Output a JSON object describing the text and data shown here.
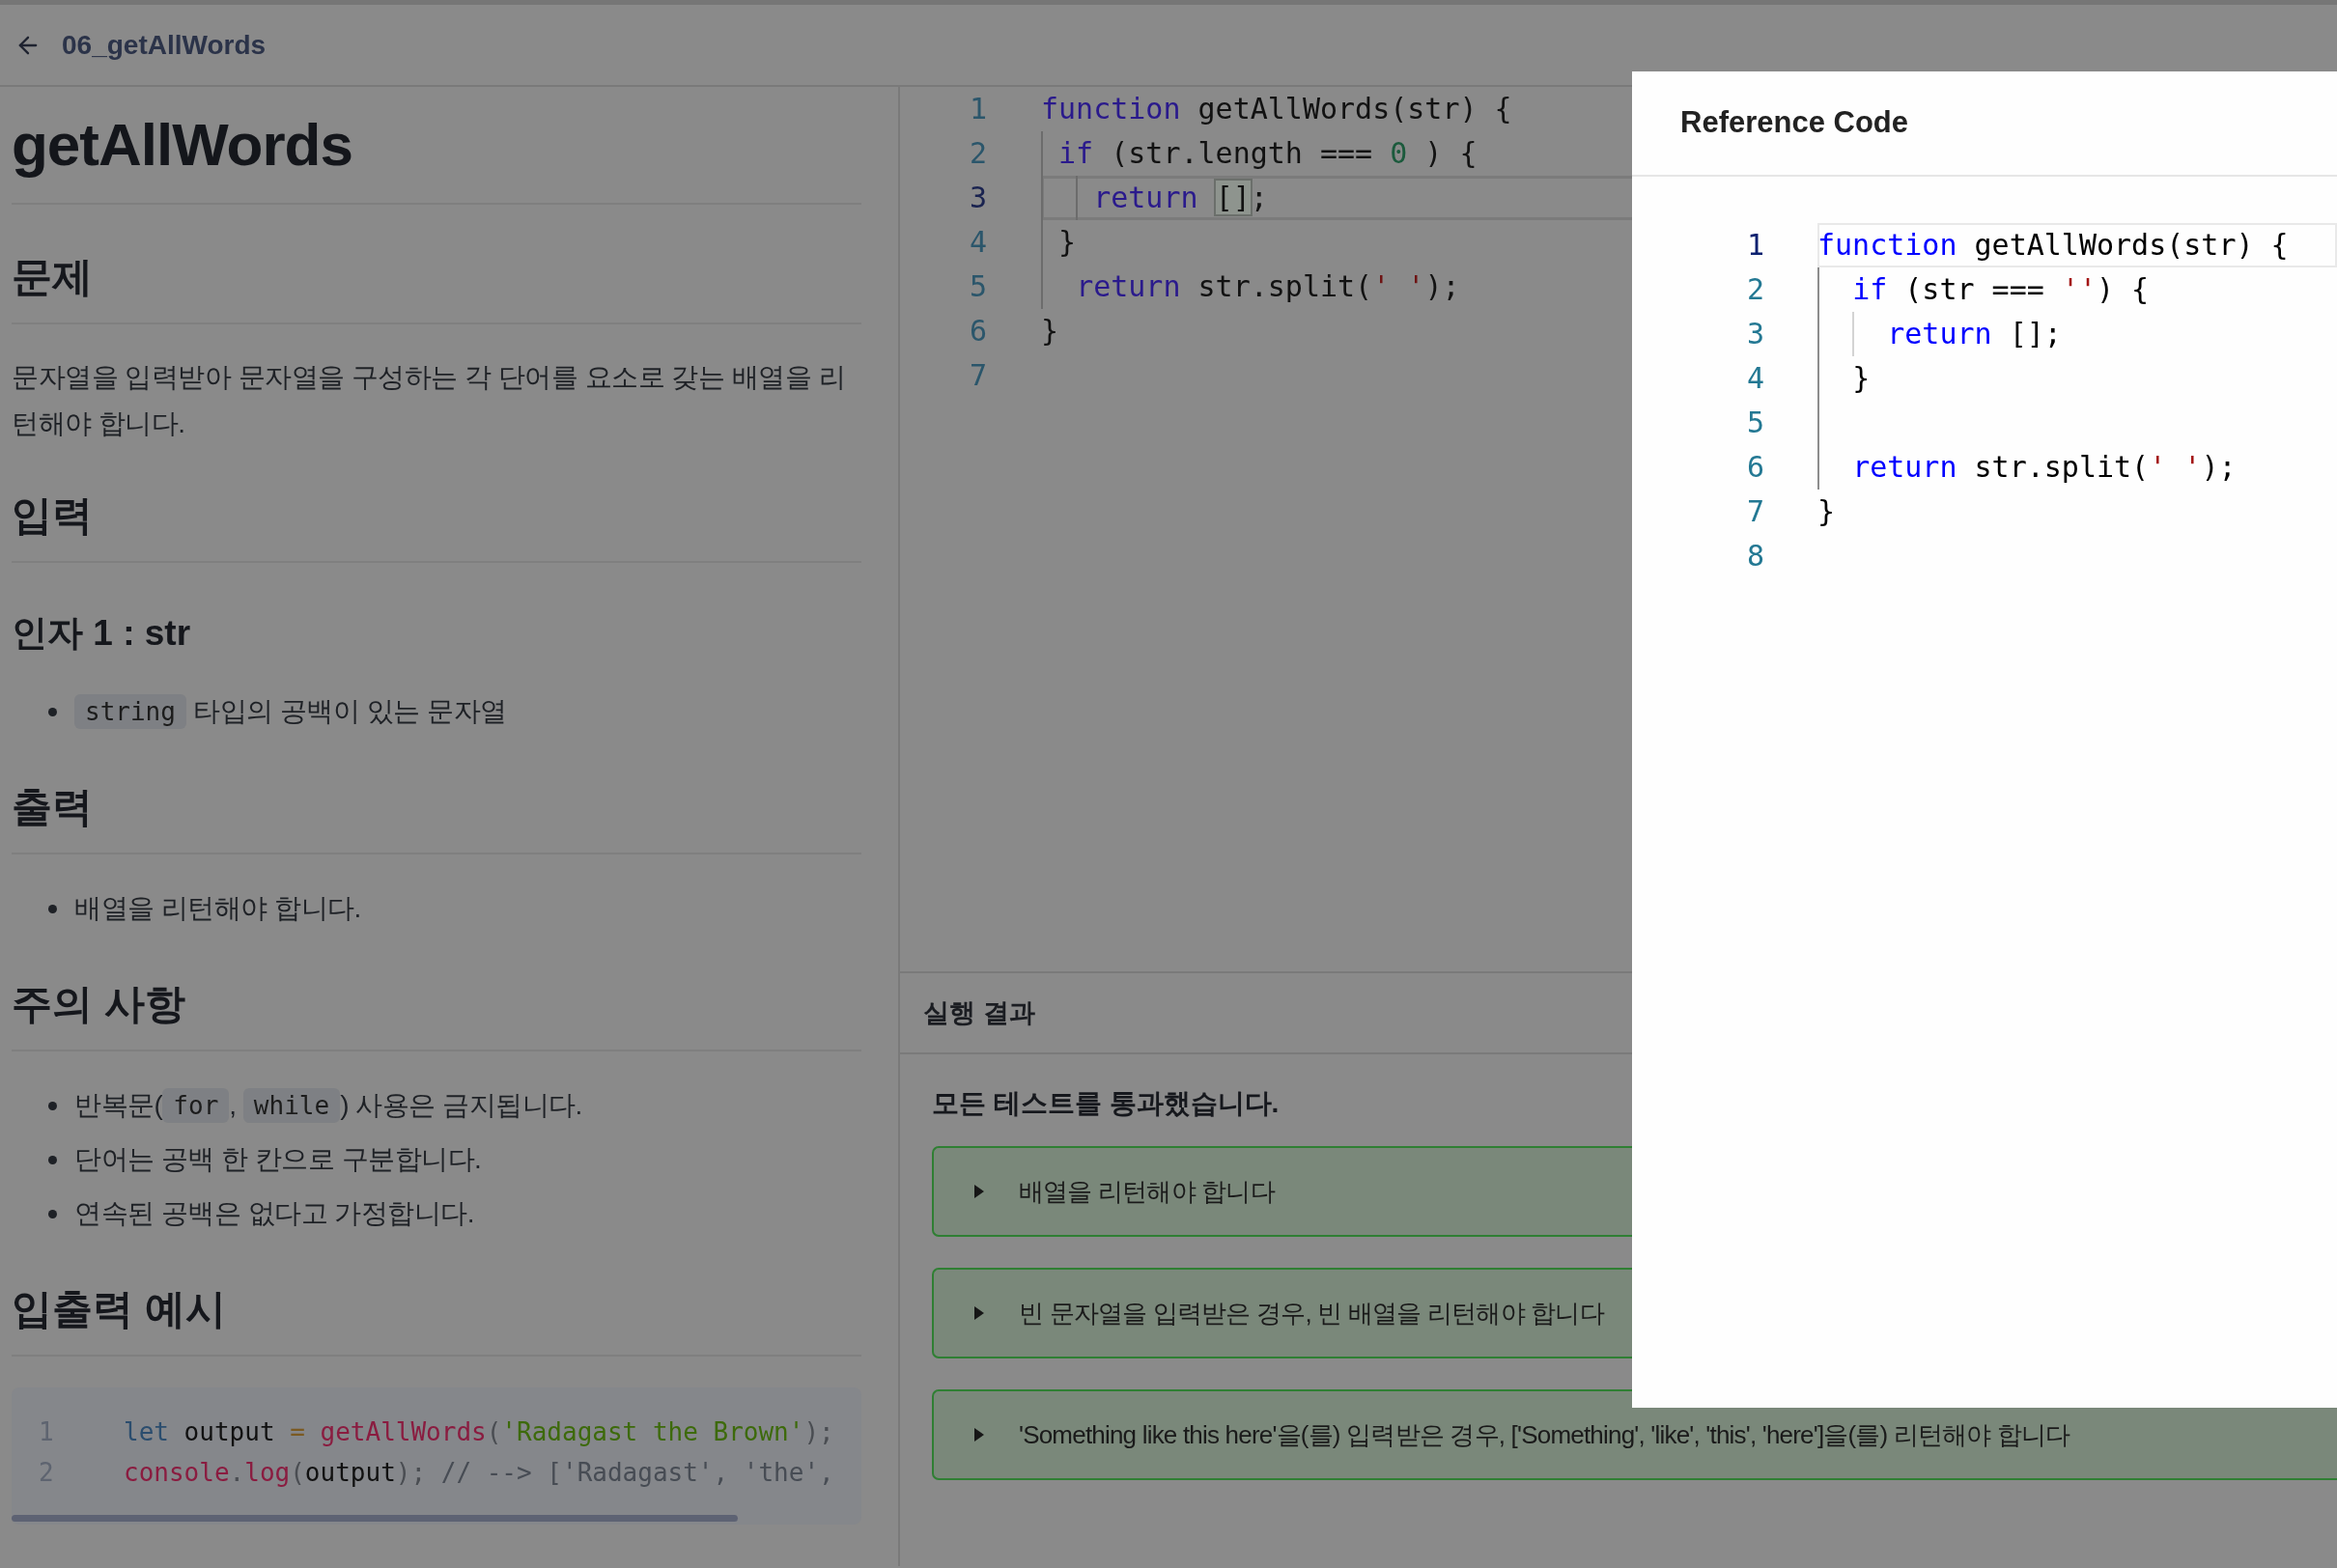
{
  "header": {
    "title": "06_getAllWords"
  },
  "problem": [
    {
      "kind": "h1",
      "text": "getAllWords"
    },
    {
      "kind": "h2",
      "text": "문제"
    },
    {
      "kind": "paragraph",
      "text": "문자열을 입력받아 문자열을 구성하는 각 단어를 요소로 갖는 배열을 리턴해야 합니다."
    },
    {
      "kind": "h2",
      "text": "입력"
    },
    {
      "kind": "h3",
      "text": "인자 1 : str"
    },
    {
      "kind": "list",
      "items": [
        [
          {
            "kind": "code",
            "text": "string"
          },
          {
            "kind": "text",
            "text": " 타입의 공백이 있는 문자열"
          }
        ]
      ]
    },
    {
      "kind": "h2",
      "text": "출력"
    },
    {
      "kind": "list",
      "items": [
        [
          {
            "kind": "text",
            "text": "배열을 리턴해야 합니다."
          }
        ]
      ]
    },
    {
      "kind": "h2",
      "text": "주의 사항"
    },
    {
      "kind": "list",
      "items": [
        [
          {
            "kind": "text",
            "text": "반복문("
          },
          {
            "kind": "code",
            "text": "for"
          },
          {
            "kind": "text",
            "text": ", "
          },
          {
            "kind": "code",
            "text": "while"
          },
          {
            "kind": "text",
            "text": ") 사용은 금지됩니다."
          }
        ],
        [
          {
            "kind": "text",
            "text": "단어는 공백 한 칸으로 구분합니다."
          }
        ],
        [
          {
            "kind": "text",
            "text": "연속된 공백은 없다고 가정합니다."
          }
        ]
      ]
    },
    {
      "kind": "h2",
      "text": "입출력 예시"
    },
    {
      "kind": "code",
      "lines": [
        {
          "number": "1",
          "tokens": [
            {
              "kind": "keyword",
              "text": "let"
            },
            {
              "kind": "plain",
              "text": " output "
            },
            {
              "kind": "operator",
              "text": "="
            },
            {
              "kind": "function",
              "text": " getAllWords"
            },
            {
              "kind": "punctuation",
              "text": "("
            },
            {
              "kind": "string",
              "text": "'Radagast the Brown'"
            },
            {
              "kind": "punctuation",
              "text": ");"
            }
          ]
        },
        {
          "number": "2",
          "tokens": [
            {
              "kind": "function",
              "text": "console"
            },
            {
              "kind": "punctuation",
              "text": "."
            },
            {
              "kind": "function",
              "text": "log"
            },
            {
              "kind": "punctuation",
              "text": "("
            },
            {
              "kind": "plain",
              "text": "output"
            },
            {
              "kind": "punctuation",
              "text": ");"
            },
            {
              "kind": "comment",
              "text": " // --> ['Radagast', 'the',"
            }
          ]
        }
      ]
    }
  ],
  "editor": {
    "lines": [
      {
        "number": "1",
        "current": false,
        "tokens": [
          {
            "kind": "keyword",
            "text": "function"
          },
          {
            "kind": "plain",
            "text": " getAllWords(str) {"
          }
        ]
      },
      {
        "number": "2",
        "current": false,
        "tokens": [
          {
            "kind": "keyword",
            "text": " if"
          },
          {
            "kind": "plain",
            "text": " (str.length === "
          },
          {
            "kind": "number",
            "text": "0"
          },
          {
            "kind": "plain",
            "text": " ) {"
          }
        ]
      },
      {
        "number": "3",
        "current": true,
        "tokens": [
          {
            "kind": "keyword",
            "text": "   return "
          },
          {
            "kind": "bracket_match",
            "text": "[]"
          },
          {
            "kind": "plain",
            "text": ";"
          }
        ]
      },
      {
        "number": "4",
        "current": false,
        "tokens": [
          {
            "kind": "plain",
            "text": " }"
          }
        ]
      },
      {
        "number": "5",
        "current": false,
        "tokens": [
          {
            "kind": "keyword",
            "text": "  return"
          },
          {
            "kind": "plain",
            "text": " str.split("
          },
          {
            "kind": "string",
            "text": "' '"
          },
          {
            "kind": "plain",
            "text": ");"
          }
        ]
      },
      {
        "number": "6",
        "current": false,
        "tokens": [
          {
            "kind": "plain",
            "text": "}"
          }
        ]
      },
      {
        "number": "7",
        "current": false
      }
    ]
  },
  "results": {
    "title": "실행 결과",
    "summary": "모든 테스트를 통과했습니다.",
    "tests": [
      {
        "label": "배열을 리턴해야 합니다",
        "passed": true,
        "expanded": false
      },
      {
        "label": "빈 문자열을 입력받은 경우, 빈 배열을 리턴해야 합니다",
        "passed": true,
        "expanded": false
      },
      {
        "label": "'Something like this here'을(를) 입력받은 경우, ['Something', 'like', 'this', 'here']을(를) 리턴해야 합니다",
        "passed": true,
        "expanded": false
      }
    ]
  },
  "reference_modal": {
    "title": "Reference Code",
    "lines": [
      {
        "number": "1",
        "current": true,
        "tokens": [
          {
            "kind": "keyword",
            "text": "function"
          },
          {
            "kind": "plain",
            "text": " getAllWords(str) {"
          }
        ]
      },
      {
        "number": "2",
        "current": false,
        "tokens": [
          {
            "kind": "keyword",
            "text": "  if"
          },
          {
            "kind": "plain",
            "text": " (str === "
          },
          {
            "kind": "string",
            "text": "''"
          },
          {
            "kind": "plain",
            "text": ") {"
          }
        ]
      },
      {
        "number": "3",
        "current": false,
        "tokens": [
          {
            "kind": "keyword",
            "text": "    return"
          },
          {
            "kind": "plain",
            "text": " [];"
          }
        ]
      },
      {
        "number": "4",
        "current": false,
        "tokens": [
          {
            "kind": "plain",
            "text": "  }"
          }
        ]
      },
      {
        "number": "5",
        "current": false
      },
      {
        "number": "6",
        "current": false,
        "tokens": [
          {
            "kind": "keyword",
            "text": "  return"
          },
          {
            "kind": "plain",
            "text": " str.split("
          },
          {
            "kind": "string",
            "text": "' '"
          },
          {
            "kind": "plain",
            "text": ");"
          }
        ]
      },
      {
        "number": "7",
        "current": false,
        "tokens": [
          {
            "kind": "plain",
            "text": "}"
          }
        ]
      },
      {
        "number": "8",
        "current": false
      }
    ]
  }
}
